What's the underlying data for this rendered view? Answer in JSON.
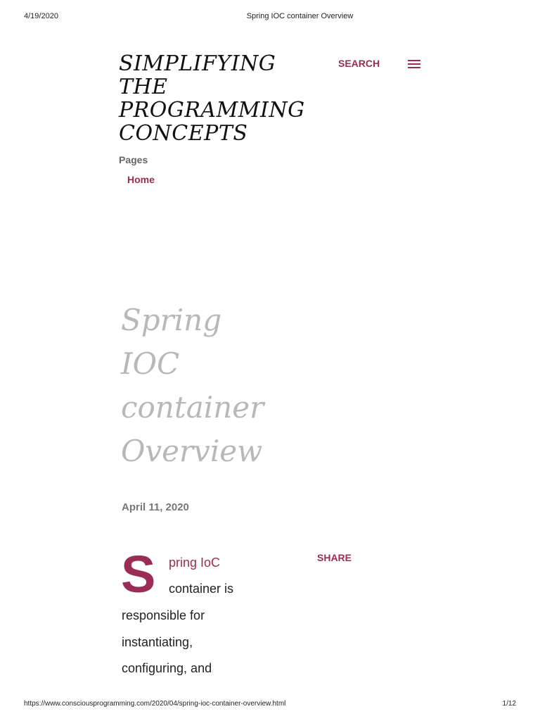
{
  "print_header": {
    "date": "4/19/2020",
    "title": "Spring IOC container Overview"
  },
  "blog": {
    "title": "SIMPLIFYING THE PROGRAMMING CONCEPTS",
    "search_label": "SEARCH",
    "menu_icon": "hamburger-menu-icon"
  },
  "pages": {
    "label": "Pages",
    "items": [
      {
        "label": "Home"
      }
    ]
  },
  "post": {
    "title": "Spring IOC container Overview",
    "date": "April 11, 2020",
    "share_label": "SHARE",
    "drop_cap": "S",
    "body_lines": [
      "pring IoC",
      "container is",
      "responsible for",
      "instantiating,",
      "configuring, and"
    ]
  },
  "print_footer": {
    "url": "https://www.consciousprogramming.com/2020/04/spring-ioc-container-overview.html",
    "page": "1/12"
  },
  "colors": {
    "accent": "#9b2c55",
    "title_gray": "#b8b8b8",
    "date_gray": "#777777"
  }
}
